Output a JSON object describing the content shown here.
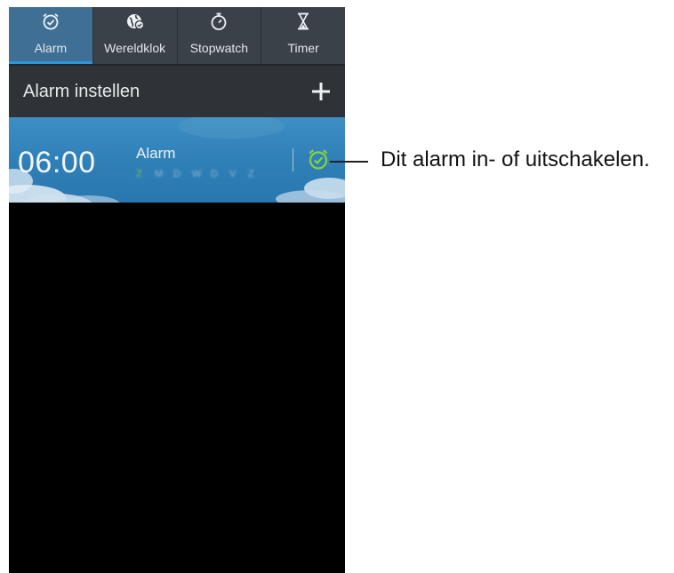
{
  "tabs": [
    {
      "label": "Alarm",
      "icon": "alarm-clock-icon",
      "active": true
    },
    {
      "label": "Wereldklok",
      "icon": "globe-clock-icon",
      "active": false
    },
    {
      "label": "Stopwatch",
      "icon": "stopwatch-icon",
      "active": false
    },
    {
      "label": "Timer",
      "icon": "hourglass-icon",
      "active": false
    }
  ],
  "set_alarm": {
    "label": "Alarm instellen",
    "icon": "plus-icon"
  },
  "alarm": {
    "time": "06:00",
    "name": "Alarm",
    "days": [
      "Z",
      "M",
      "D",
      "W",
      "D",
      "V",
      "Z"
    ],
    "toggle_icon": "alarm-toggle-icon"
  },
  "callout": {
    "text": "Dit alarm in- of uitschakelen."
  },
  "colors": {
    "tab_active": "#3f6f95",
    "tab_bar": "#3a4149",
    "alarm_bg": "#2f7fb7",
    "toggle_green": "#7ed321",
    "underline": "#2e95d7"
  }
}
